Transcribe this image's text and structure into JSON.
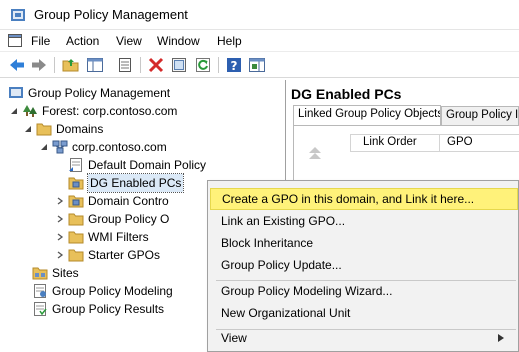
{
  "window": {
    "title": "Group Policy Management"
  },
  "menu": {
    "items": [
      "File",
      "Action",
      "View",
      "Window",
      "Help"
    ]
  },
  "toolbar": {
    "buttons": [
      "back-icon",
      "forward-icon",
      "up-folder-icon",
      "show-hide-tree-icon",
      "properties-sheet-icon",
      "delete-icon",
      "export-list-icon",
      "refresh-icon",
      "help-icon",
      "show-action-pane-icon"
    ]
  },
  "tree": {
    "root": "Group Policy Management",
    "forest": "Forest: corp.contoso.com",
    "domains": "Domains",
    "domain": "corp.contoso.com",
    "default_policy": "Default Domain Policy",
    "dg_enabled": "DG Enabled PCs",
    "domain_controllers": "Domain Contro",
    "gpo": "Group Policy O",
    "wmi": "WMI Filters",
    "starter": "Starter GPOs",
    "sites": "Sites",
    "modeling": "Group Policy Modeling",
    "results": "Group Policy Results"
  },
  "right": {
    "title": "DG Enabled PCs",
    "tab_linked": "Linked Group Policy Objects",
    "tab_inheritance": "Group Policy Inh",
    "col_link_order": "Link Order",
    "col_gpo": "GPO"
  },
  "context_menu": {
    "items": [
      "Create a GPO in this domain, and Link it here...",
      "Link an Existing GPO...",
      "Block Inheritance",
      "Group Policy Update...",
      "Group Policy Modeling Wizard...",
      "New Organizational Unit",
      "View"
    ]
  },
  "colors": {
    "highlight": "#fff27a",
    "folder": "#e8c05a",
    "accent": "#1e6fc4"
  }
}
